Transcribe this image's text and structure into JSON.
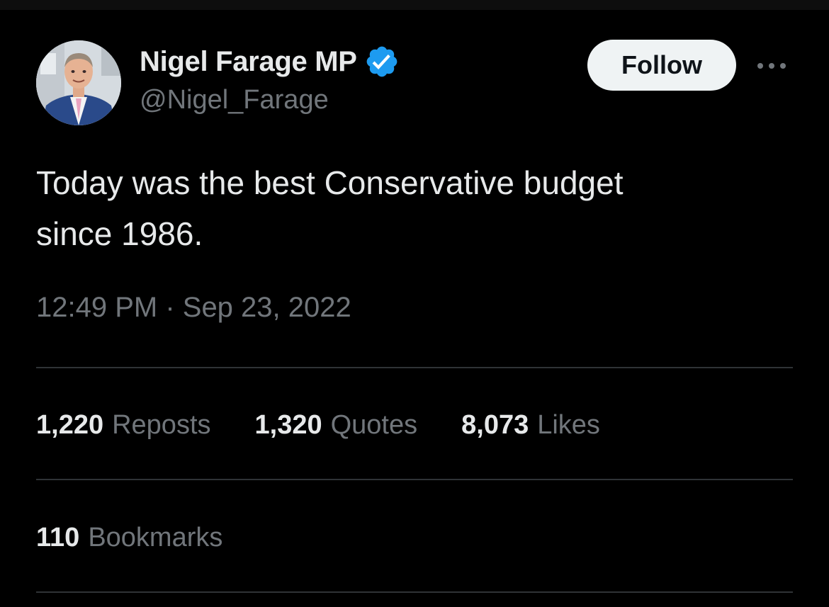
{
  "author": {
    "display_name": "Nigel Farage MP",
    "handle": "@Nigel_Farage",
    "verified_icon": "verified-badge-icon",
    "verified_color": "#1d9bf0"
  },
  "follow": {
    "label": "Follow"
  },
  "more_icon": "more-horizontal-icon",
  "tweet": {
    "text": "Today was the best Conservative budget\nsince 1986.",
    "timestamp": "12:49 PM · Sep 23, 2022"
  },
  "stats": [
    {
      "count": "1,220",
      "label": "Reposts"
    },
    {
      "count": "1,320",
      "label": "Quotes"
    },
    {
      "count": "8,073",
      "label": "Likes"
    }
  ],
  "bookmarks": {
    "count": "110",
    "label": "Bookmarks"
  },
  "colors": {
    "background": "#000000",
    "primary_text": "#e7e9ea",
    "secondary_text": "#71767b",
    "divider": "#2f3336",
    "follow_button_bg": "#eff3f4"
  }
}
